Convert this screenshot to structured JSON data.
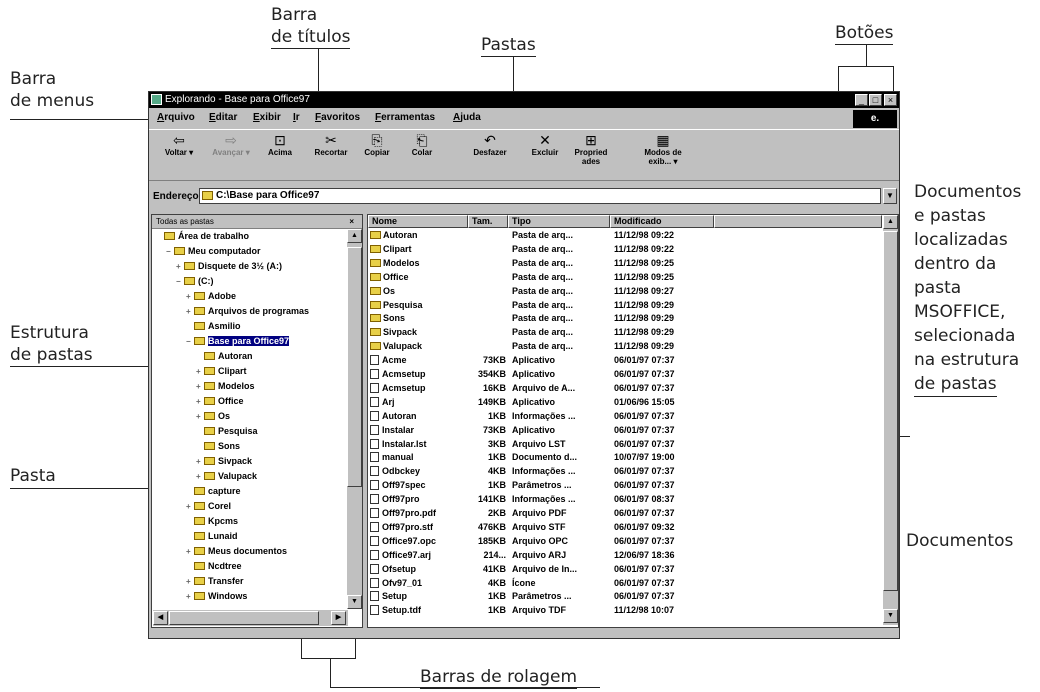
{
  "callouts": {
    "barra_titulos_1": "Barra",
    "barra_titulos_2": "de títulos",
    "pastas": "Pastas",
    "botoes": "Botões",
    "barra_menus_1": "Barra",
    "barra_menus_2": "de menus",
    "documentos_pastas": [
      "Documentos",
      "e pastas",
      "localizadas",
      "dentro da",
      "pasta",
      "MSOFFICE,",
      "selecionada",
      "na estrutura",
      "de pastas"
    ],
    "estrutura_1": "Estrutura",
    "estrutura_2": "de pastas",
    "pasta": "Pasta",
    "documentos": "Documentos",
    "barras_rolagem": "Barras de rolagem"
  },
  "window": {
    "title": "Explorando - Base para Office97",
    "buttons": {
      "minimize": "_",
      "maximize": "□",
      "close": "×"
    },
    "menu": [
      "Arquivo",
      "Editar",
      "Exibir",
      "Ir",
      "Favoritos",
      "Ferramentas",
      "Ajuda"
    ],
    "toolbar": [
      {
        "label": "Voltar",
        "icon": "⇦"
      },
      {
        "label": "Avançar",
        "icon": "⇨"
      },
      {
        "label": "Acima",
        "icon": "⊡"
      },
      {
        "label": "Recortar",
        "icon": "✂"
      },
      {
        "label": "Copiar",
        "icon": "⎘"
      },
      {
        "label": "Colar",
        "icon": "⎗"
      },
      {
        "label": "Desfazer",
        "icon": "↶"
      },
      {
        "label": "Excluir",
        "icon": "✕"
      },
      {
        "label": "Propried ades",
        "icon": "⊞"
      },
      {
        "label": "Modos de exib...",
        "icon": "▦"
      }
    ],
    "address_label": "Endereço",
    "address_value": "C:\\Base para Office97",
    "tree_header": "Todas as pastas",
    "tree_close": "×",
    "tree": [
      {
        "label": "Área de trabalho",
        "indent": 0,
        "pm": ""
      },
      {
        "label": "Meu computador",
        "indent": 1,
        "pm": "−"
      },
      {
        "label": "Disquete de 3½ (A:)",
        "indent": 2,
        "pm": "+"
      },
      {
        "label": "(C:)",
        "indent": 2,
        "pm": "−"
      },
      {
        "label": "Adobe",
        "indent": 3,
        "pm": "+"
      },
      {
        "label": "Arquivos de programas",
        "indent": 3,
        "pm": "+"
      },
      {
        "label": "Asmilio",
        "indent": 3,
        "pm": ""
      },
      {
        "label": "Base para Office97",
        "indent": 3,
        "pm": "−",
        "selected": true
      },
      {
        "label": "Autoran",
        "indent": 4,
        "pm": ""
      },
      {
        "label": "Clipart",
        "indent": 4,
        "pm": "+"
      },
      {
        "label": "Modelos",
        "indent": 4,
        "pm": "+"
      },
      {
        "label": "Office",
        "indent": 4,
        "pm": "+"
      },
      {
        "label": "Os",
        "indent": 4,
        "pm": "+"
      },
      {
        "label": "Pesquisa",
        "indent": 4,
        "pm": ""
      },
      {
        "label": "Sons",
        "indent": 4,
        "pm": ""
      },
      {
        "label": "Sivpack",
        "indent": 4,
        "pm": "+"
      },
      {
        "label": "Valupack",
        "indent": 4,
        "pm": "+"
      },
      {
        "label": "capture",
        "indent": 3,
        "pm": ""
      },
      {
        "label": "Corel",
        "indent": 3,
        "pm": "+"
      },
      {
        "label": "Kpcms",
        "indent": 3,
        "pm": ""
      },
      {
        "label": "Lunaid",
        "indent": 3,
        "pm": ""
      },
      {
        "label": "Meus documentos",
        "indent": 3,
        "pm": "+"
      },
      {
        "label": "Ncdtree",
        "indent": 3,
        "pm": ""
      },
      {
        "label": "Transfer",
        "indent": 3,
        "pm": "+"
      },
      {
        "label": "Windows",
        "indent": 3,
        "pm": "+"
      }
    ],
    "columns": [
      "Nome",
      "Tam.",
      "Tipo",
      "Modificado"
    ],
    "files": [
      {
        "name": "Autoran",
        "size": "",
        "type": "Pasta de arq...",
        "date": "11/12/98 09:22",
        "folder": true
      },
      {
        "name": "Clipart",
        "size": "",
        "type": "Pasta de arq...",
        "date": "11/12/98 09:22",
        "folder": true
      },
      {
        "name": "Modelos",
        "size": "",
        "type": "Pasta de arq...",
        "date": "11/12/98 09:25",
        "folder": true
      },
      {
        "name": "Office",
        "size": "",
        "type": "Pasta de arq...",
        "date": "11/12/98 09:25",
        "folder": true
      },
      {
        "name": "Os",
        "size": "",
        "type": "Pasta de arq...",
        "date": "11/12/98 09:27",
        "folder": true
      },
      {
        "name": "Pesquisa",
        "size": "",
        "type": "Pasta de arq...",
        "date": "11/12/98 09:29",
        "folder": true
      },
      {
        "name": "Sons",
        "size": "",
        "type": "Pasta de arq...",
        "date": "11/12/98 09:29",
        "folder": true
      },
      {
        "name": "Sivpack",
        "size": "",
        "type": "Pasta de arq...",
        "date": "11/12/98 09:29",
        "folder": true
      },
      {
        "name": "Valupack",
        "size": "",
        "type": "Pasta de arq...",
        "date": "11/12/98 09:29",
        "folder": true
      },
      {
        "name": "Acme",
        "size": "73KB",
        "type": "Aplicativo",
        "date": "06/01/97 07:37",
        "folder": false
      },
      {
        "name": "Acmsetup",
        "size": "354KB",
        "type": "Aplicativo",
        "date": "06/01/97 07:37",
        "folder": false
      },
      {
        "name": "Acmsetup",
        "size": "16KB",
        "type": "Arquivo de A...",
        "date": "06/01/97 07:37",
        "folder": false
      },
      {
        "name": "Arj",
        "size": "149KB",
        "type": "Aplicativo",
        "date": "01/06/96 15:05",
        "folder": false
      },
      {
        "name": "Autoran",
        "size": "1KB",
        "type": "Informações ...",
        "date": "06/01/97 07:37",
        "folder": false
      },
      {
        "name": "Instalar",
        "size": "73KB",
        "type": "Aplicativo",
        "date": "06/01/97 07:37",
        "folder": false
      },
      {
        "name": "Instalar.lst",
        "size": "3KB",
        "type": "Arquivo LST",
        "date": "06/01/97 07:37",
        "folder": false
      },
      {
        "name": "manual",
        "size": "1KB",
        "type": "Documento d...",
        "date": "10/07/97 19:00",
        "folder": false
      },
      {
        "name": "Odbckey",
        "size": "4KB",
        "type": "Informações ...",
        "date": "06/01/97 07:37",
        "folder": false
      },
      {
        "name": "Off97spec",
        "size": "1KB",
        "type": "Parâmetros ...",
        "date": "06/01/97 07:37",
        "folder": false
      },
      {
        "name": "Off97pro",
        "size": "141KB",
        "type": "Informações ...",
        "date": "06/01/97 08:37",
        "folder": false
      },
      {
        "name": "Off97pro.pdf",
        "size": "2KB",
        "type": "Arquivo PDF",
        "date": "06/01/97 07:37",
        "folder": false
      },
      {
        "name": "Off97pro.stf",
        "size": "476KB",
        "type": "Arquivo STF",
        "date": "06/01/97 09:32",
        "folder": false
      },
      {
        "name": "Office97.opc",
        "size": "185KB",
        "type": "Arquivo OPC",
        "date": "06/01/97 07:37",
        "folder": false
      },
      {
        "name": "Office97.arj",
        "size": "214...",
        "type": "Arquivo ARJ",
        "date": "12/06/97 18:36",
        "folder": false
      },
      {
        "name": "Ofsetup",
        "size": "41KB",
        "type": "Arquivo de In...",
        "date": "06/01/97 07:37",
        "folder": false
      },
      {
        "name": "Ofv97_01",
        "size": "4KB",
        "type": "Ícone",
        "date": "06/01/97 07:37",
        "folder": false
      },
      {
        "name": "Setup",
        "size": "1KB",
        "type": "Parâmetros ...",
        "date": "06/01/97 07:37",
        "folder": false
      },
      {
        "name": "Setup.tdf",
        "size": "1KB",
        "type": "Arquivo TDF",
        "date": "11/12/98 10:07",
        "folder": false
      }
    ]
  }
}
